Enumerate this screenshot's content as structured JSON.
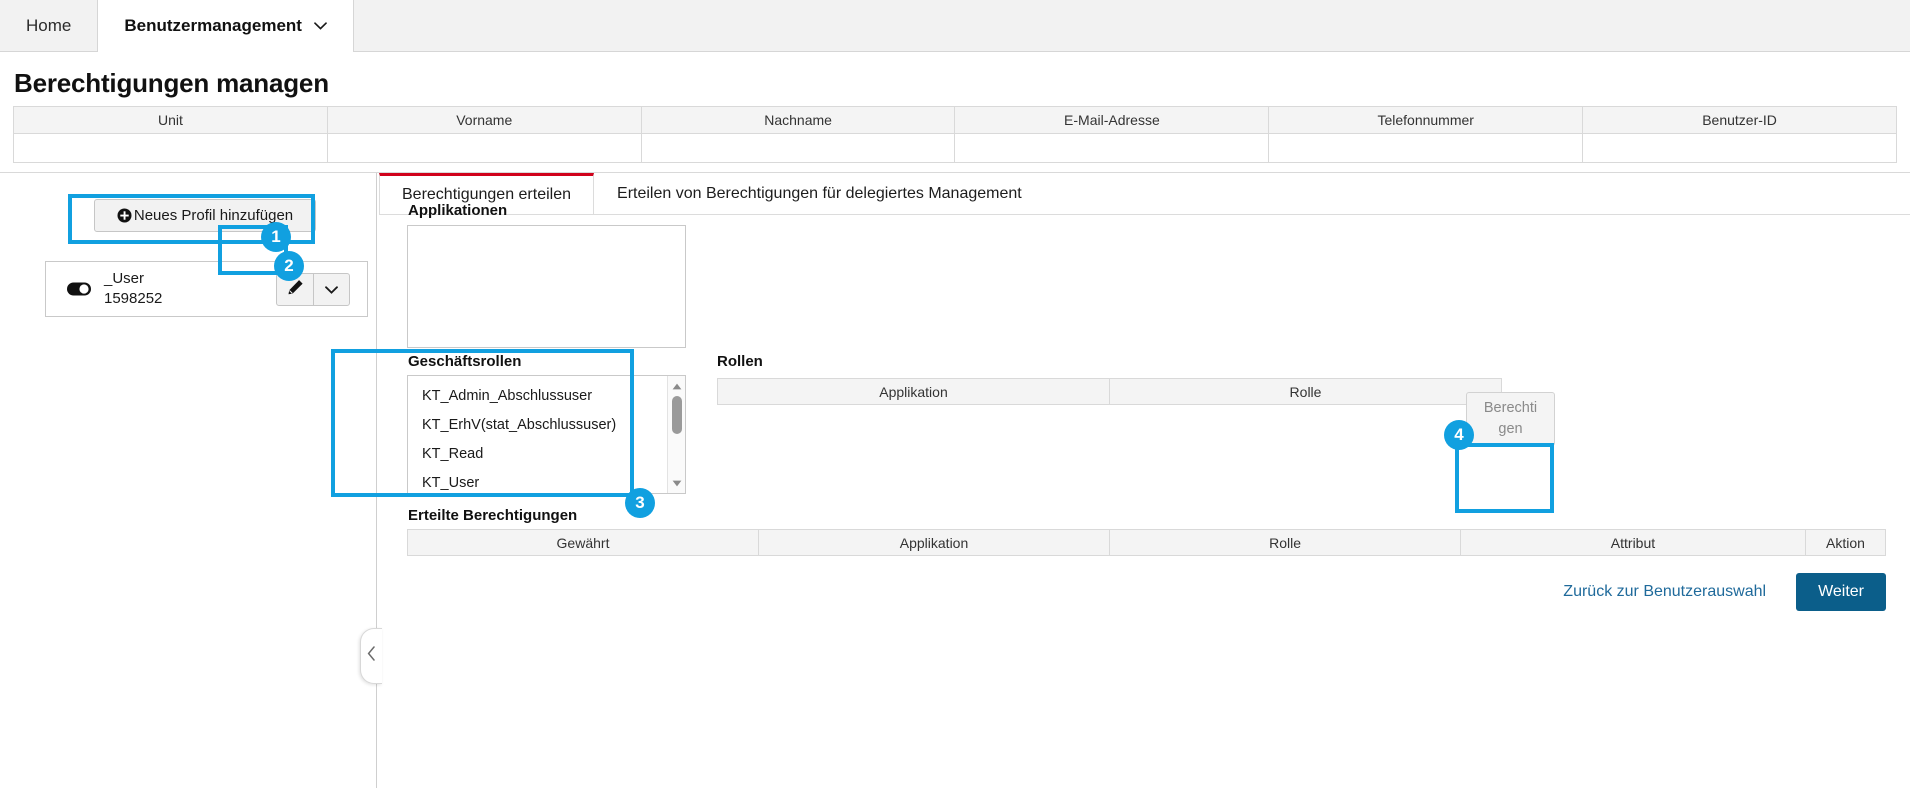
{
  "nav": {
    "items": [
      {
        "label": "Home",
        "active": false
      },
      {
        "label": "Benutzermanagement",
        "active": true
      }
    ]
  },
  "page": {
    "title": "Berechtigungen managen"
  },
  "user_table": {
    "columns": [
      "Unit",
      "Vorname",
      "Nachname",
      "E-Mail-Adresse",
      "Telefonnummer",
      "Benutzer-ID"
    ],
    "rows": [
      [
        "",
        "",
        "",
        "",
        "",
        ""
      ]
    ]
  },
  "left_panel": {
    "add_profile_label": "Neues Profil hinzufügen",
    "add_profile_icon": "plus-circle-icon",
    "profile": {
      "toggle_icon": "toggle-icon",
      "name": "_User",
      "id": "1598252",
      "edit_icon": "pencil-icon",
      "more_icon": "chevron-down-icon"
    },
    "collapse_icon": "chevron-left-icon"
  },
  "tabs": [
    {
      "label": "Berechtigungen erteilen",
      "active": true
    },
    {
      "label": "Erteilen von Berechtigungen für delegiertes Management",
      "active": false
    }
  ],
  "form": {
    "applikationen_label": "Applikationen",
    "applikationen_items": [],
    "geschaeftsrollen_label": "Geschäftsrollen",
    "geschaeftsrollen_items": [
      "KT_Admin_Abschlussuser",
      "KT_ErhV(stat_Abschlussuser)",
      "KT_Read",
      "KT_User"
    ],
    "rollen_label": "Rollen",
    "rollen_columns": [
      "Applikation",
      "Rolle"
    ],
    "berechtigen_label": "Berechtigen",
    "berechtigen_line1": "Berechti",
    "berechtigen_line2": "gen",
    "erteilte_label": "Erteilte Berechtigungen",
    "erteilte_columns": [
      "Gewährt",
      "Applikation",
      "Rolle",
      "Attribut",
      "Aktion"
    ]
  },
  "footer": {
    "back_link": "Zurück zur Benutzerauswahl",
    "next_button": "Weiter"
  },
  "annotations": [
    {
      "number": "1"
    },
    {
      "number": "2"
    },
    {
      "number": "3"
    },
    {
      "number": "4"
    }
  ],
  "colors": {
    "accent_blue": "#11a0e0",
    "tab_active_red": "#d0021b",
    "primary_button": "#0b5e8a",
    "link": "#1f6a9b"
  }
}
